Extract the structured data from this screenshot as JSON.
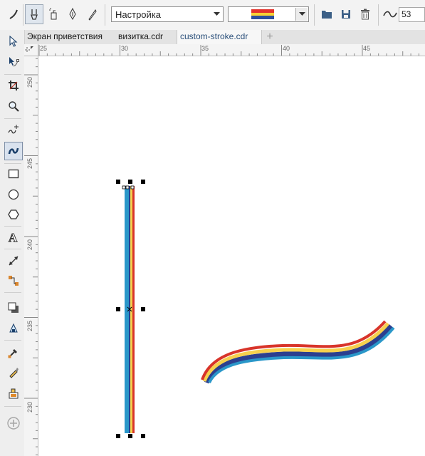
{
  "property_bar": {
    "preset_value": "Настройка",
    "stroke_colors": [
      "#e3322b",
      "#f7d033",
      "#2d4f9d"
    ],
    "smoothing_value": "53",
    "buttons": [
      "artistic-media-preset-icon",
      "brush-icon",
      "sprayer-icon",
      "calligraphic-icon",
      "pressure-icon",
      "browse-folder-icon",
      "save-icon",
      "delete-icon",
      "smoothing-icon"
    ]
  },
  "tabs": [
    {
      "label": "Экран приветствия",
      "active": false
    },
    {
      "label": "визитка.cdr",
      "active": false
    },
    {
      "label": "custom-stroke.cdr",
      "active": true
    }
  ],
  "tools": [
    "pick-tool-icon",
    "shape-tool-icon",
    "crop-tool-icon",
    "zoom-tool-icon",
    "freehand-tool-icon",
    "artistic-media-tool-icon",
    "rectangle-tool-icon",
    "ellipse-tool-icon",
    "polygon-tool-icon",
    "text-tool-icon",
    "parallel-dimension-tool-icon",
    "connector-tool-icon",
    "drop-shadow-tool-icon",
    "transparency-tool-icon",
    "eyedropper-tool-icon",
    "interactive-fill-tool-icon",
    "smart-fill-tool-icon",
    "add-tool-icon"
  ],
  "rulers": {
    "horizontal_labels": [
      "25",
      "30",
      "35",
      "40",
      "45"
    ],
    "vertical_labels": [
      "250",
      "245",
      "240",
      "235",
      "230"
    ]
  },
  "colors": {
    "stroke_red": "#d8342a",
    "stroke_yellow": "#f6d04d",
    "stroke_navy": "#2c3f8f",
    "stroke_blue": "#2a97c9",
    "active_tab_text": "#2a4f7a"
  }
}
